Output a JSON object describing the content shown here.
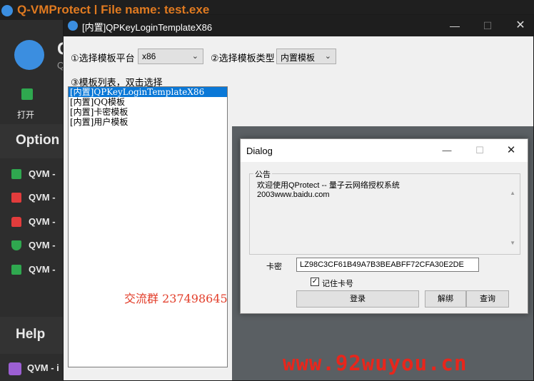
{
  "colors": {
    "accent_blue": "#0a78d7",
    "brand_orange": "#e07a20",
    "qq_red": "#e23c28",
    "watermark_red": "#e8261c",
    "item_green": "#2fa84f",
    "item_red": "#e23c3c",
    "item_purple": "#9c5fd3"
  },
  "background_app": {
    "title": "Q-VMProtect | File name: test.exe",
    "logo_letter": "Q",
    "logo_letter2": "Q",
    "open_label": "打开",
    "options_heading": "Option",
    "items": [
      {
        "label": "QVM -",
        "icon": "monitor-icon",
        "color": "#2fa84f"
      },
      {
        "label": "QVM -",
        "icon": "list-icon",
        "color": "#e23c3c"
      },
      {
        "label": "QVM -",
        "icon": "lock-icon",
        "color": "#e23c3c"
      },
      {
        "label": "QVM -",
        "icon": "shield-check-icon",
        "color": "#2fa84f"
      },
      {
        "label": "QVM -",
        "icon": "list-icon",
        "color": "#2fa84f"
      }
    ],
    "help_heading": "Help",
    "help_item": "QVM - i"
  },
  "template_window": {
    "title": "[内置]QPKeyLoginTemplateX86",
    "platform_label": "①选择模板平台",
    "platform_value": "x86",
    "type_label": "②选择模板类型",
    "type_value": "内置模板",
    "list_label": "③模板列表，双击选择",
    "list_items": [
      {
        "label": "[内置]QPKeyLoginTemplateX86",
        "selected": true
      },
      {
        "label": "[内置]QQ模板",
        "selected": false
      },
      {
        "label": "[内置]卡密模板",
        "selected": false
      },
      {
        "label": "[内置]用户模板",
        "selected": false
      }
    ],
    "qq_group": "交流群 237498645"
  },
  "dialog": {
    "title": "Dialog",
    "group_label": "公告",
    "notice_line1": "欢迎使用QProtect -- 量子云网络授权系统",
    "notice_line2": "2003www.baidu.com",
    "card_label": "卡密",
    "card_value": "LZ98C3CF61B49A7B3BEABFF72CFA30E2DE",
    "remember_label": "记住卡号",
    "remember_checked": true,
    "login_label": "登录",
    "unbind_label": "解绑",
    "query_label": "查询"
  },
  "watermark": "www.92wuyou.cn"
}
